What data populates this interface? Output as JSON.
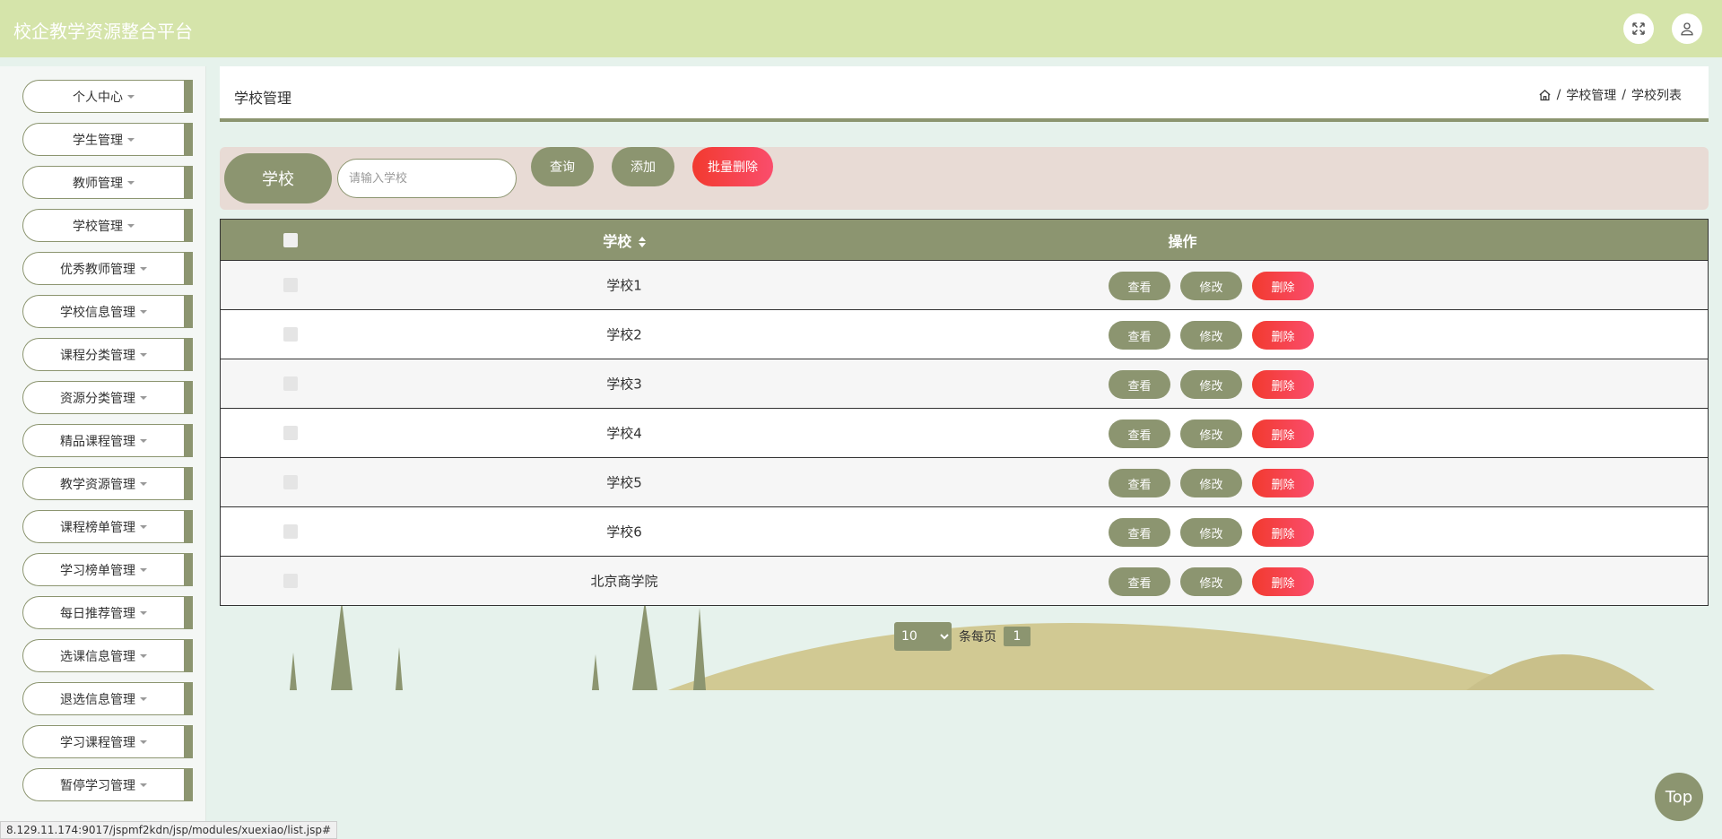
{
  "app": {
    "title": "校企教学资源整合平台"
  },
  "topbar": {
    "fullscreen_icon": "expand-icon",
    "user_icon": "user-icon"
  },
  "sidebar": {
    "items": [
      {
        "label": "个人中心"
      },
      {
        "label": "学生管理"
      },
      {
        "label": "教师管理"
      },
      {
        "label": "学校管理"
      },
      {
        "label": "优秀教师管理"
      },
      {
        "label": "学校信息管理"
      },
      {
        "label": "课程分类管理"
      },
      {
        "label": "资源分类管理"
      },
      {
        "label": "精品课程管理"
      },
      {
        "label": "教学资源管理"
      },
      {
        "label": "课程榜单管理"
      },
      {
        "label": "学习榜单管理"
      },
      {
        "label": "每日推荐管理"
      },
      {
        "label": "选课信息管理"
      },
      {
        "label": "退选信息管理"
      },
      {
        "label": "学习课程管理"
      },
      {
        "label": "暂停学习管理"
      }
    ]
  },
  "page": {
    "title": "学校管理",
    "breadcrumb": {
      "level1": "学校管理",
      "level2": "学校列表",
      "sep": "/"
    }
  },
  "search": {
    "label": "学校",
    "placeholder": "请输入学校",
    "value": "",
    "query_label": "查询",
    "add_label": "添加",
    "batch_delete_label": "批量删除"
  },
  "table": {
    "headers": {
      "name": "学校",
      "ops": "操作"
    },
    "rows": [
      {
        "name": "学校1"
      },
      {
        "name": "学校2"
      },
      {
        "name": "学校3"
      },
      {
        "name": "学校4"
      },
      {
        "name": "学校5"
      },
      {
        "name": "学校6"
      },
      {
        "name": "北京商学院"
      }
    ],
    "op_labels": {
      "view": "查看",
      "edit": "修改",
      "delete": "删除"
    }
  },
  "pager": {
    "page_size": "10",
    "page_size_options": [
      "10"
    ],
    "per_page_text": "条每页",
    "current_page": "1"
  },
  "top_button": "Top",
  "status_url": "8.129.11.174:9017/jspmf2kdn/jsp/modules/xuexiao/list.jsp#",
  "colors": {
    "accent": "#8c9570",
    "topbar": "#d5e4aa",
    "danger": "#f23a2f"
  }
}
